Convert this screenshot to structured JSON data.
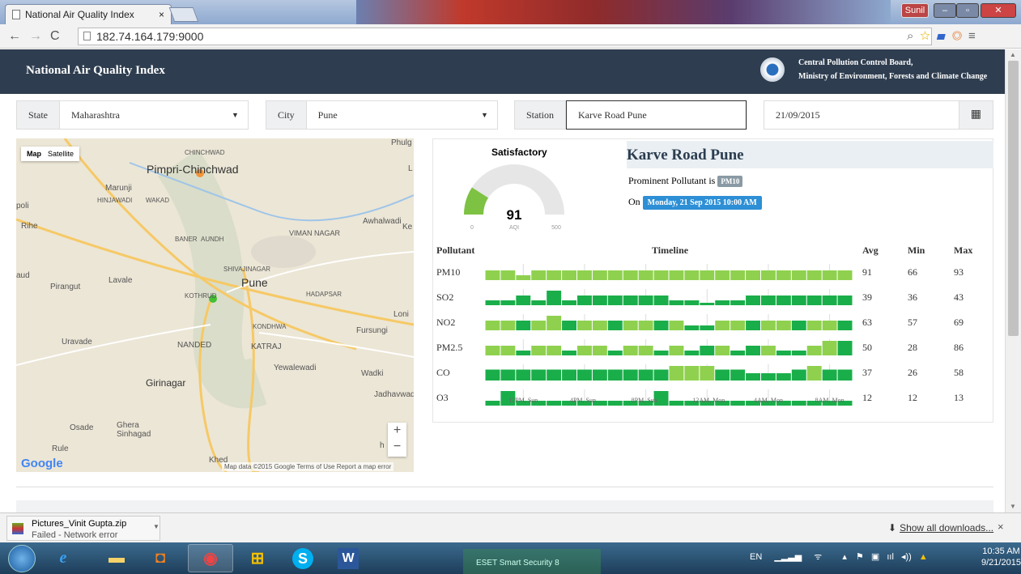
{
  "browser": {
    "tab_title": "National Air Quality Index",
    "tab_close": "×",
    "user": "Sunil",
    "url": "182.74.164.179:9000"
  },
  "header": {
    "title": "National Air Quality Index",
    "org_line1": "Central Pollution Control Board,",
    "org_line2": "Ministry of Environment, Forests and Climate Change"
  },
  "filters": {
    "state_label": "State",
    "state_value": "Maharashtra",
    "city_label": "City",
    "city_value": "Pune",
    "station_label": "Station",
    "station_value": "Karve Road Pune",
    "date_value": "21/09/2015"
  },
  "map": {
    "type_map": "Map",
    "type_satellite": "Satellite",
    "labels": [
      "Pimpri-Chinchwad",
      "Pune",
      "Marunji",
      "HINJAWADI",
      "WAKAD",
      "Phulg",
      "Rihe",
      "Lavale",
      "Pirangut",
      "KOTHRUD",
      "BANER",
      "AUNDH",
      "SHIVAJINAGAR",
      "VIMAN NAGAR",
      "Awhalwadi",
      "HADAPSAR",
      "Loni",
      "KONDHWA",
      "Fursungi",
      "Uravade",
      "NANDED",
      "KATRAJ",
      "Yewalewadi",
      "Wadki",
      "Girinagar",
      "Jadhavwad",
      "Osade",
      "Ghera Sinhagad",
      "Rule",
      "Khed",
      "CHINCHWAD",
      "poli",
      "aud",
      "Ke",
      "L",
      "h"
    ],
    "zoom_in": "+",
    "zoom_out": "−",
    "google": "Google",
    "attribution": "Map data ©2015 Google   Terms of Use   Report a map error"
  },
  "aqi": {
    "condition": "Satisfactory",
    "value": 91,
    "value_text": "91",
    "unit": "AQI",
    "min": "0",
    "max": "500",
    "gauge_color": "#7dc242"
  },
  "station": {
    "name": "Karve Road Pune",
    "prominent_prefix": "Prominent Pollutant is",
    "prominent": "PM10",
    "on_prefix": "On",
    "datetime": "Monday, 21 Sep 2015 10:00 AM"
  },
  "table": {
    "headers": {
      "pollutant": "Pollutant",
      "timeline": "Timeline",
      "avg": "Avg",
      "min": "Min",
      "max": "Max"
    },
    "rows": [
      {
        "name": "PM10",
        "avg": "91",
        "min": "66",
        "max": "93",
        "bars": [
          2,
          2,
          1,
          2,
          2,
          2,
          2,
          2,
          2,
          2,
          2,
          2,
          2,
          2,
          2,
          2,
          2,
          2,
          2,
          2,
          2,
          2,
          2,
          2
        ],
        "palette": "light"
      },
      {
        "name": "SO2",
        "avg": "39",
        "min": "36",
        "max": "43",
        "bars": [
          1,
          1,
          2,
          1,
          3,
          1,
          2,
          2,
          2,
          2,
          2,
          2,
          1,
          1,
          0.5,
          1,
          1,
          2,
          2,
          2,
          2,
          2,
          2,
          2
        ],
        "palette": "dark"
      },
      {
        "name": "NO2",
        "avg": "63",
        "min": "57",
        "max": "69",
        "bars": [
          2,
          2,
          2,
          2,
          3,
          2,
          2,
          2,
          2,
          2,
          2,
          2,
          2,
          1,
          1,
          2,
          2,
          2,
          2,
          2,
          2,
          2,
          2,
          2
        ],
        "palette": "mixed"
      },
      {
        "name": "PM2.5",
        "avg": "50",
        "min": "28",
        "max": "86",
        "bars": [
          2,
          2,
          1,
          2,
          2,
          1,
          2,
          2,
          1,
          2,
          2,
          1,
          2,
          1,
          2,
          2,
          1,
          2,
          2,
          1,
          1,
          2,
          3,
          3
        ],
        "palette": "mixed"
      },
      {
        "name": "CO",
        "avg": "37",
        "min": "26",
        "max": "58",
        "bars": [
          3,
          3,
          3,
          3,
          3,
          3,
          3,
          3,
          3,
          3,
          3,
          3,
          4,
          4,
          4,
          3,
          3,
          2,
          2,
          2,
          3,
          4,
          3,
          3
        ],
        "palette": "co"
      },
      {
        "name": "O3",
        "avg": "12",
        "min": "12",
        "max": "13",
        "bars": [
          1,
          3,
          1,
          1,
          1,
          1,
          1,
          1,
          1,
          1,
          1,
          3,
          1,
          1,
          1,
          1,
          1,
          1,
          1,
          1,
          1,
          1,
          1,
          1
        ],
        "palette": "dark"
      }
    ],
    "axis_labels": [
      "12PM, Sun",
      "4PM, Sun",
      "8PM, Sun",
      "12AM, Mon",
      "4AM, Mon",
      "8AM, Mon"
    ]
  },
  "downloads": {
    "file": "Pictures_Vinit Gupta.zip",
    "status": "Failed - Network error",
    "show_all": "Show all downloads...",
    "close": "×"
  },
  "taskbar": {
    "lang": "EN",
    "time": "10:35 AM",
    "date": "9/21/2015",
    "ghost": "ESET Smart Security 8"
  },
  "colors": {
    "header_bg": "#2e3d4f",
    "light_green": "#8fd14f",
    "dark_green": "#1aae4a",
    "prominent_badge": "#8a9aa4",
    "date_badge": "#2d8fd5"
  }
}
